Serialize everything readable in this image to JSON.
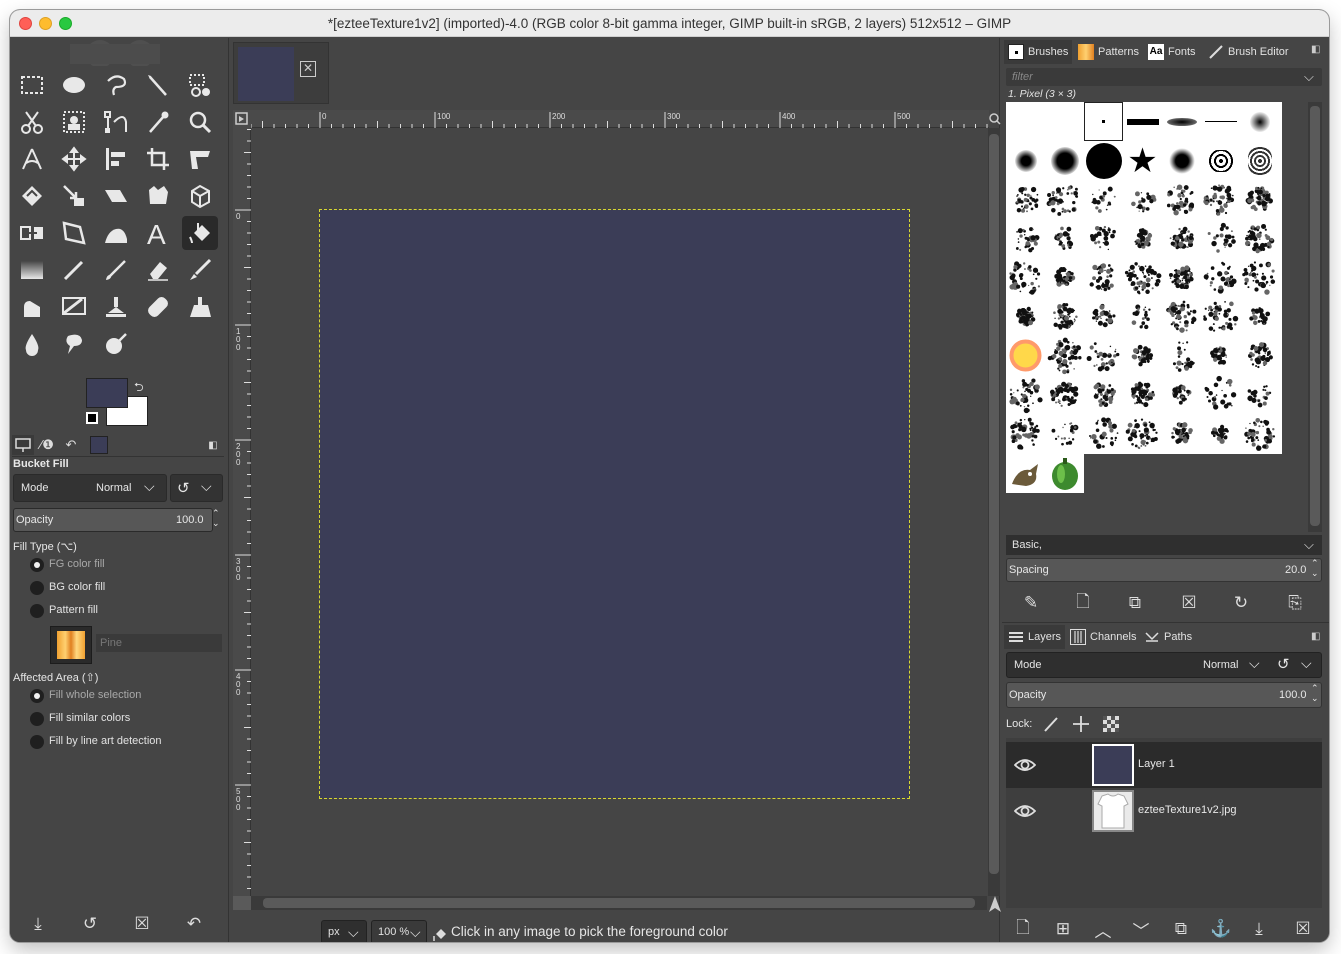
{
  "window": {
    "title": "*[ezteeTexture1v2] (imported)-4.0 (RGB color 8-bit gamma integer, GIMP built-in sRGB, 2 layers) 512x512 – GIMP"
  },
  "colors": {
    "foreground": "#3b3d57",
    "background": "#ffffff",
    "selection_marquee": "#d8d832"
  },
  "toolbox": {
    "active_tool": "bucket-fill",
    "tools": [
      "rect-select",
      "ellipse-select",
      "free-select",
      "fuzzy-select",
      "by-color-select",
      "scissors-select",
      "foreground-select",
      "paths",
      "color-picker",
      "zoom",
      "measure",
      "move",
      "align",
      "crop",
      "unified-transform",
      "rotate",
      "scale",
      "shear",
      "flip",
      "cage-transform",
      "handle-transform",
      "warp-transform",
      "perspective",
      "3d-transform",
      "text",
      "bucket-fill",
      "gradient",
      "pencil",
      "paintbrush",
      "eraser",
      "airbrush",
      "ink",
      "mypaint-brush",
      "clone",
      "perspective-clone",
      "heal",
      "smudge",
      "blur-sharpen",
      "dodge-burn"
    ]
  },
  "tool_options": {
    "title": "Bucket Fill",
    "mode_label": "Mode",
    "mode_value": "Normal",
    "opacity_label": "Opacity",
    "opacity_value": "100.0",
    "fill_type_label": "Fill Type  (⌥)",
    "fill_types": [
      "FG color fill",
      "BG color fill",
      "Pattern fill"
    ],
    "selected_fill": 0,
    "pattern_name": "Pine",
    "affected_area_label": "Affected Area  (⇧)",
    "affected_areas": [
      "Fill whole selection",
      "Fill similar colors",
      "Fill by line art detection"
    ],
    "selected_area": 0
  },
  "rulers": {
    "h_labels": [
      "0",
      "100",
      "200",
      "300",
      "400",
      "500"
    ],
    "v_labels": [
      "0",
      "100",
      "200",
      "300",
      "400",
      "500"
    ]
  },
  "statusbar": {
    "unit": "px",
    "zoom": "100 %",
    "message": "Click in any image to pick the foreground color"
  },
  "brushes_panel": {
    "tabs": [
      "Brushes",
      "Patterns",
      "Fonts",
      "Brush Editor"
    ],
    "filter_placeholder": "filter",
    "selected_brush": "1. Pixel (3 × 3)",
    "preset": "Basic,",
    "spacing_label": "Spacing",
    "spacing_value": "20.0"
  },
  "layers_panel": {
    "tabs": [
      "Layers",
      "Channels",
      "Paths"
    ],
    "mode_label": "Mode",
    "mode_value": "Normal",
    "opacity_label": "Opacity",
    "opacity_value": "100.0",
    "lock_label": "Lock:",
    "layers": [
      {
        "name": "Layer 1",
        "selected": true
      },
      {
        "name": "ezteeTexture1v2.jpg",
        "selected": false
      }
    ]
  }
}
